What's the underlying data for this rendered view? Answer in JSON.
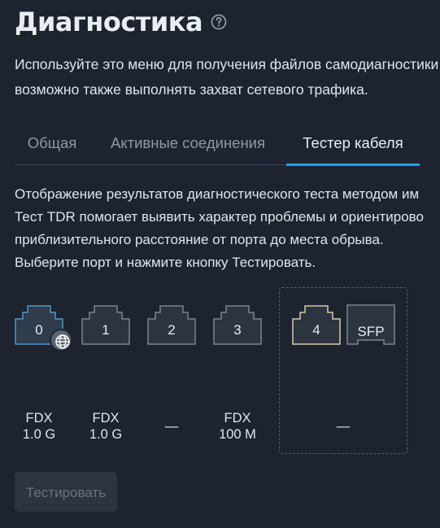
{
  "page": {
    "title": "Диагностика",
    "help_icon": "question-circle-icon",
    "intro_lines": [
      "Используйте это меню для получения файлов самодиагностики",
      "возможно также выполнять захват сетевого трафика."
    ]
  },
  "tabs": [
    {
      "label": "Общая",
      "active": false
    },
    {
      "label": "Активные соединения",
      "active": false
    },
    {
      "label": "Тестер кабеля",
      "active": true
    }
  ],
  "description_lines": [
    "Отображение результатов диагностического теста методом им",
    "Тест TDR помогает выявить характер проблемы и ориентирово",
    "приблизительного расстояние от порта до места обрыва.",
    "Выберите порт и нажмите кнопку Тестировать."
  ],
  "ports": [
    {
      "number": "0",
      "state": "selected",
      "wan": true,
      "status_line1": "FDX",
      "status_line2": "1.0 G"
    },
    {
      "number": "1",
      "state": "normal",
      "wan": false,
      "status_line1": "FDX",
      "status_line2": "1.0 G"
    },
    {
      "number": "2",
      "state": "normal",
      "wan": false,
      "status_line1": "—",
      "status_line2": ""
    },
    {
      "number": "3",
      "state": "normal",
      "wan": false,
      "status_line1": "FDX",
      "status_line2": "100 M"
    },
    {
      "number": "4",
      "state": "combo",
      "wan": false
    }
  ],
  "sfp": {
    "label": "SFP"
  },
  "combo_status": "—",
  "wan_badge_icon": "globe-icon",
  "colors": {
    "background": "#1d2430",
    "accent": "#2f9be6",
    "port_selected_border": "#4f95cc",
    "port_selected_fill": "#2e3c4c",
    "port_combo_border": "#d9c9a6",
    "port_border": "#7a8390",
    "port_fill": "#2c3440"
  },
  "actions": {
    "test_label": "Тестировать",
    "test_enabled": false
  }
}
